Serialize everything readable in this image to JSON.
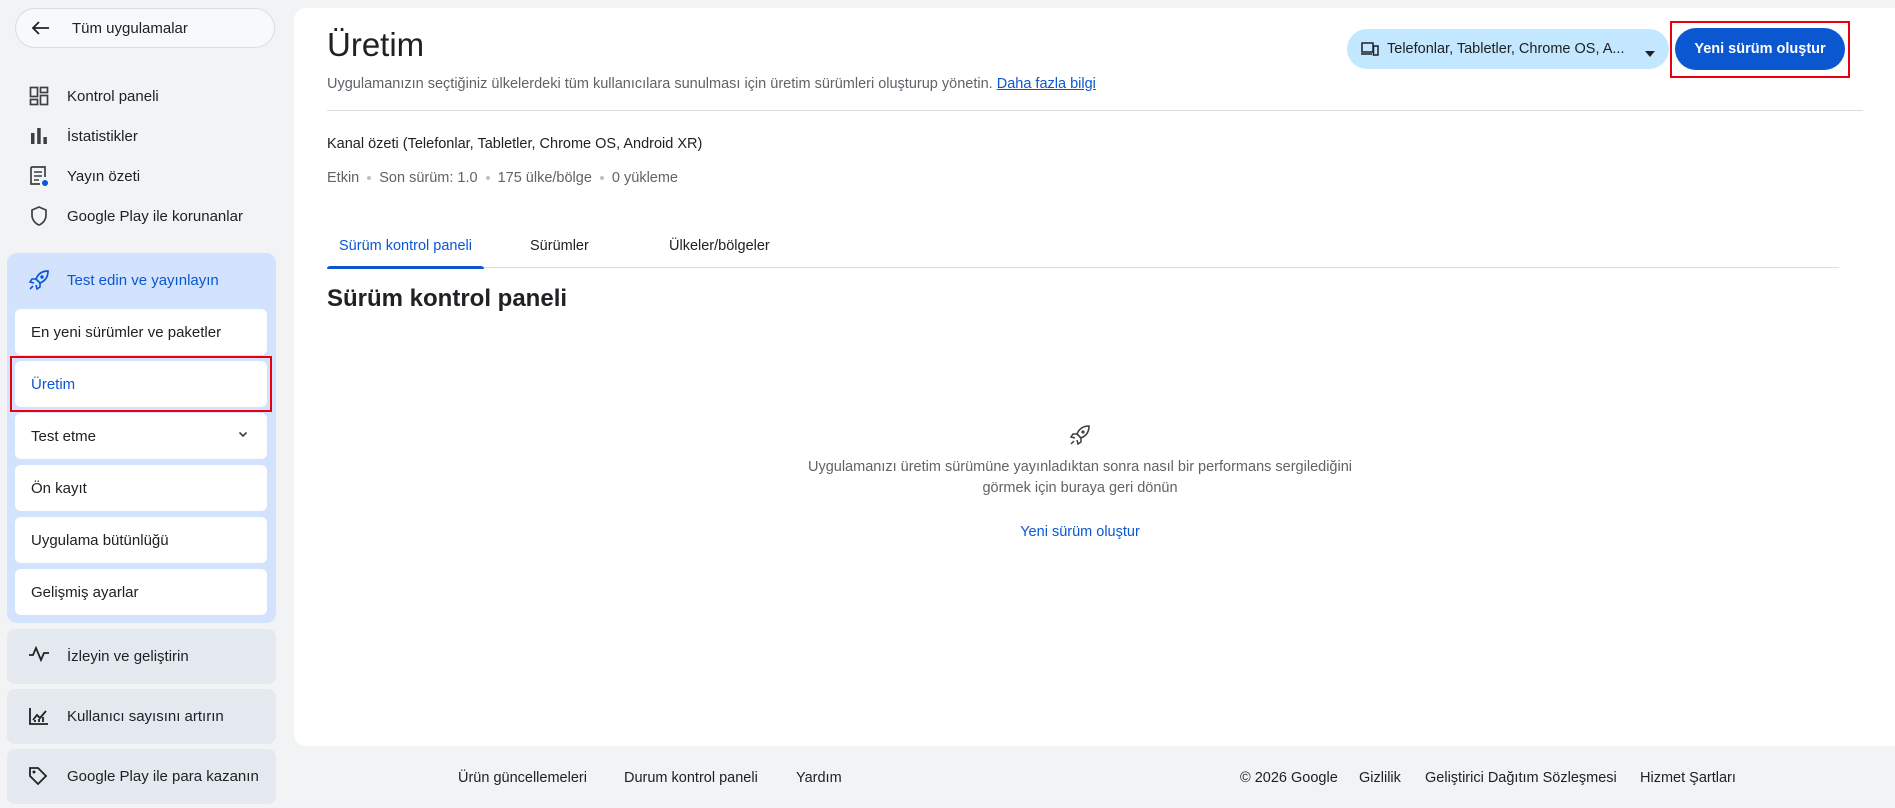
{
  "sidebar": {
    "back_label": "Tüm uygulamalar",
    "items": [
      {
        "label": "Kontrol paneli",
        "icon": "dashboard-icon"
      },
      {
        "label": "İstatistikler",
        "icon": "bar-chart-icon"
      },
      {
        "label": "Yayın özeti",
        "icon": "publishing-overview-icon"
      },
      {
        "label": "Google Play ile korunanlar",
        "icon": "shield-icon"
      }
    ],
    "group": {
      "label": "Test edin ve yayınlayın",
      "icon": "rocket-icon",
      "sub_items": [
        {
          "label": "En yeni sürümler ve paketler"
        },
        {
          "label": "Üretim",
          "active": true
        },
        {
          "label": "Test etme",
          "expandable": true
        },
        {
          "label": "Ön kayıt"
        },
        {
          "label": "Uygulama bütünlüğü"
        },
        {
          "label": "Gelişmiş ayarlar"
        }
      ]
    },
    "sections": [
      {
        "label": "İzleyin ve geliştirin",
        "icon": "pulse-icon"
      },
      {
        "label": "Kullanıcı sayısını artırın",
        "icon": "growth-chart-icon"
      },
      {
        "label": "Google Play ile para kazanın",
        "icon": "tag-icon"
      }
    ]
  },
  "header": {
    "title": "Üretim",
    "subtitle": "Uygulamanızın seçtiğiniz ülkelerdeki tüm kullanıcılara sunulması için üretim sürümleri oluşturup yönetin.",
    "learn_more": "Daha fazla bilgi",
    "device_selector": "Telefonlar, Tabletler, Chrome OS, A...",
    "create_release_button": "Yeni sürüm oluştur"
  },
  "channel": {
    "title": "Kanal özeti (Telefonlar, Tabletler, Chrome OS, Android XR)",
    "stats": [
      "Etkin",
      "Son sürüm: 1.0",
      "175 ülke/bölge",
      "0 yükleme"
    ]
  },
  "tabs": [
    {
      "label": "Sürüm kontrol paneli",
      "active": true
    },
    {
      "label": "Sürümler"
    },
    {
      "label": "Ülkeler/bölgeler"
    }
  ],
  "dashboard": {
    "title": "Sürüm kontrol paneli",
    "empty_line1": "Uygulamanızı üretim sürümüne yayınladıktan sonra nasıl bir performans sergilediğini",
    "empty_line2": "görmek için buraya geri dönün",
    "empty_link": "Yeni sürüm oluştur"
  },
  "footer": {
    "links": [
      "Ürün güncellemeleri",
      "Durum kontrol paneli",
      "Yardım"
    ],
    "copyright": "© 2026 Google",
    "legal": [
      "Gizlilik",
      "Geliştirici Dağıtım Sözleşmesi",
      "Hizmet Şartları"
    ]
  },
  "colors": {
    "accent": "#0b57d0",
    "highlight_box": "#e8000b",
    "selector_bg": "#c2e7ff",
    "group_bg": "#d3e3fd"
  }
}
